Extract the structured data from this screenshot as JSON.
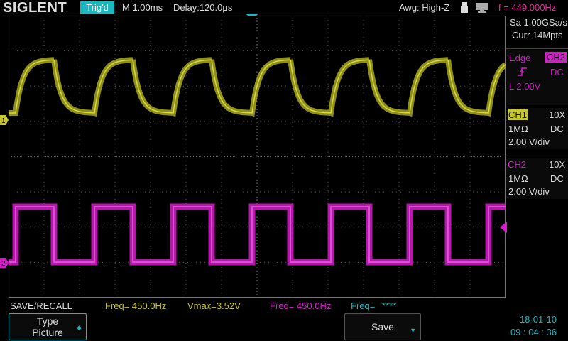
{
  "header": {
    "brand": "SIGLENT",
    "trigger_status": "Trig'd",
    "timebase": "M 1.00ms",
    "delay": "Delay:120.0μs",
    "awg": "Awg: High-Z",
    "freq": "f = 449.000Hz",
    "usb_icon": "usb-icon",
    "display_icon": "monitor-icon"
  },
  "acq": {
    "sample_rate": "Sa 1.00GSa/s",
    "memory": "Curr 14Mpts"
  },
  "trigger": {
    "type": "Edge",
    "source": "CH2",
    "slope_icon": "rising-edge-icon",
    "coupling": "DC",
    "level": "L  2.00V"
  },
  "ch1": {
    "name": "CH1",
    "probe": "10X",
    "impedance": "1MΩ",
    "coupling": "DC",
    "scale": "2.00 V/div",
    "color": "#c8c82a",
    "marker": "1"
  },
  "ch2": {
    "name": "CH2",
    "probe": "10X",
    "impedance": "1MΩ",
    "coupling": "DC",
    "scale": "2.00 V/div",
    "color": "#d21fc8",
    "marker": "2"
  },
  "measurements": {
    "menu": "SAVE/RECALL",
    "m1": "Freq= 450.0Hz",
    "m2": "Vmax=3.52V",
    "m3": "Freq= 450.0Hz",
    "m4": "Freq=",
    "m4_value": "****"
  },
  "softkeys": {
    "type_line1": "Type",
    "type_line2": "Picture",
    "save": "Save"
  },
  "datetime": {
    "date": "18-01-10",
    "time": "09 : 04 : 36"
  },
  "colors": {
    "accent": "#1cb8bf",
    "ch1": "#c8c82a",
    "ch2": "#d21fc8"
  }
}
